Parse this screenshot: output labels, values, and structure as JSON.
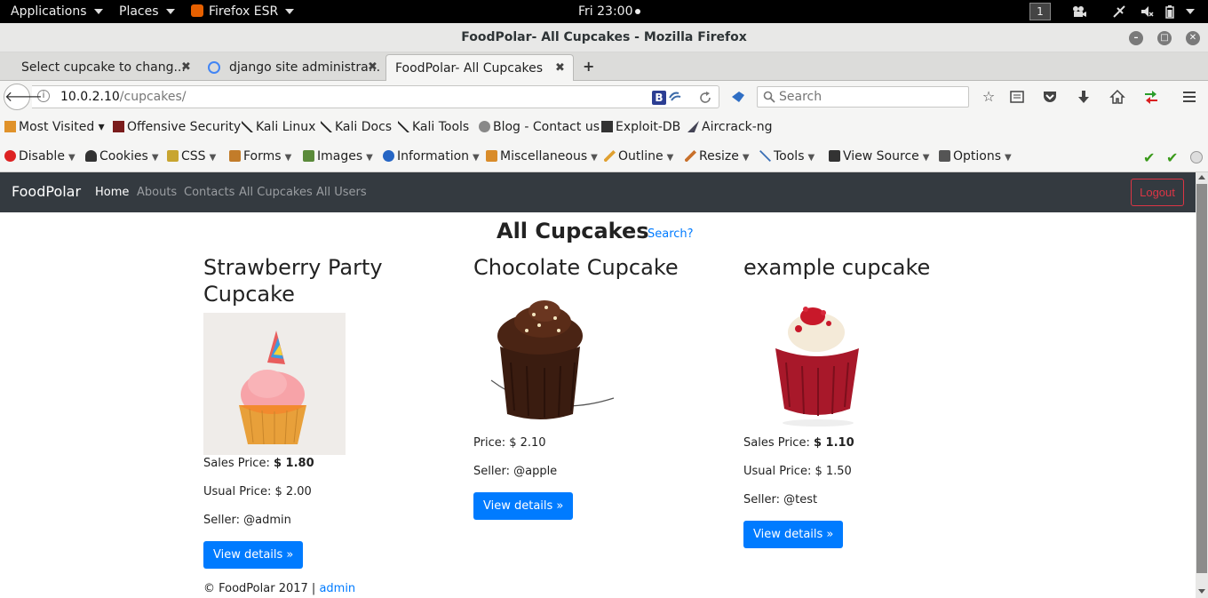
{
  "topbar": {
    "applications": "Applications",
    "places": "Places",
    "firefox": "Firefox ESR",
    "clock": "Fri 23:00",
    "workspace": "1"
  },
  "window": {
    "title": "FoodPolar- All Cupcakes - Mozilla Firefox"
  },
  "tabs": [
    {
      "label": "Select cupcake to chang..."
    },
    {
      "label": "django site administra..."
    },
    {
      "label": "FoodPolar- All Cupcakes"
    }
  ],
  "navbar": {
    "url_host": "10.0.2.10",
    "url_path": "/cupcakes/",
    "search_placeholder": "Search"
  },
  "bookmarks": [
    {
      "label": "Most Visited ▾"
    },
    {
      "label": "Offensive Security"
    },
    {
      "label": "Kali Linux"
    },
    {
      "label": "Kali Docs"
    },
    {
      "label": "Kali Tools"
    },
    {
      "label": "Blog - Contact us"
    },
    {
      "label": "Exploit-DB"
    },
    {
      "label": "Aircrack-ng"
    }
  ],
  "devbar": [
    {
      "label": "Disable"
    },
    {
      "label": "Cookies"
    },
    {
      "label": "CSS"
    },
    {
      "label": "Forms"
    },
    {
      "label": "Images"
    },
    {
      "label": "Information"
    },
    {
      "label": "Miscellaneous"
    },
    {
      "label": "Outline"
    },
    {
      "label": "Resize"
    },
    {
      "label": "Tools"
    },
    {
      "label": "View Source"
    },
    {
      "label": "Options"
    }
  ],
  "site": {
    "brand": "FoodPolar",
    "nav": [
      "Home",
      "Abouts",
      "Contacts",
      "All Cupcakes",
      "All Users"
    ],
    "logout": "Logout",
    "heading": "All Cupcakes",
    "search_link": "Search?",
    "cupcakes": [
      {
        "name": "Strawberry Party Cupcake",
        "sale_label": "Sales Price:",
        "sale_value": "$ 1.80",
        "usual": "Usual Price: $ 2.00",
        "seller": "Seller: @admin",
        "button": "View details »"
      },
      {
        "name": "Chocolate Cupcake",
        "price": "Price: $ 2.10",
        "seller": "Seller: @apple",
        "button": "View details »"
      },
      {
        "name": "example cupcake",
        "sale_label": "Sales Price:",
        "sale_value": "$ 1.10",
        "usual": "Usual Price: $ 1.50",
        "seller": "Seller: @test",
        "button": "View details »"
      }
    ],
    "footer_text": "© FoodPolar 2017 |",
    "footer_link": "admin"
  }
}
